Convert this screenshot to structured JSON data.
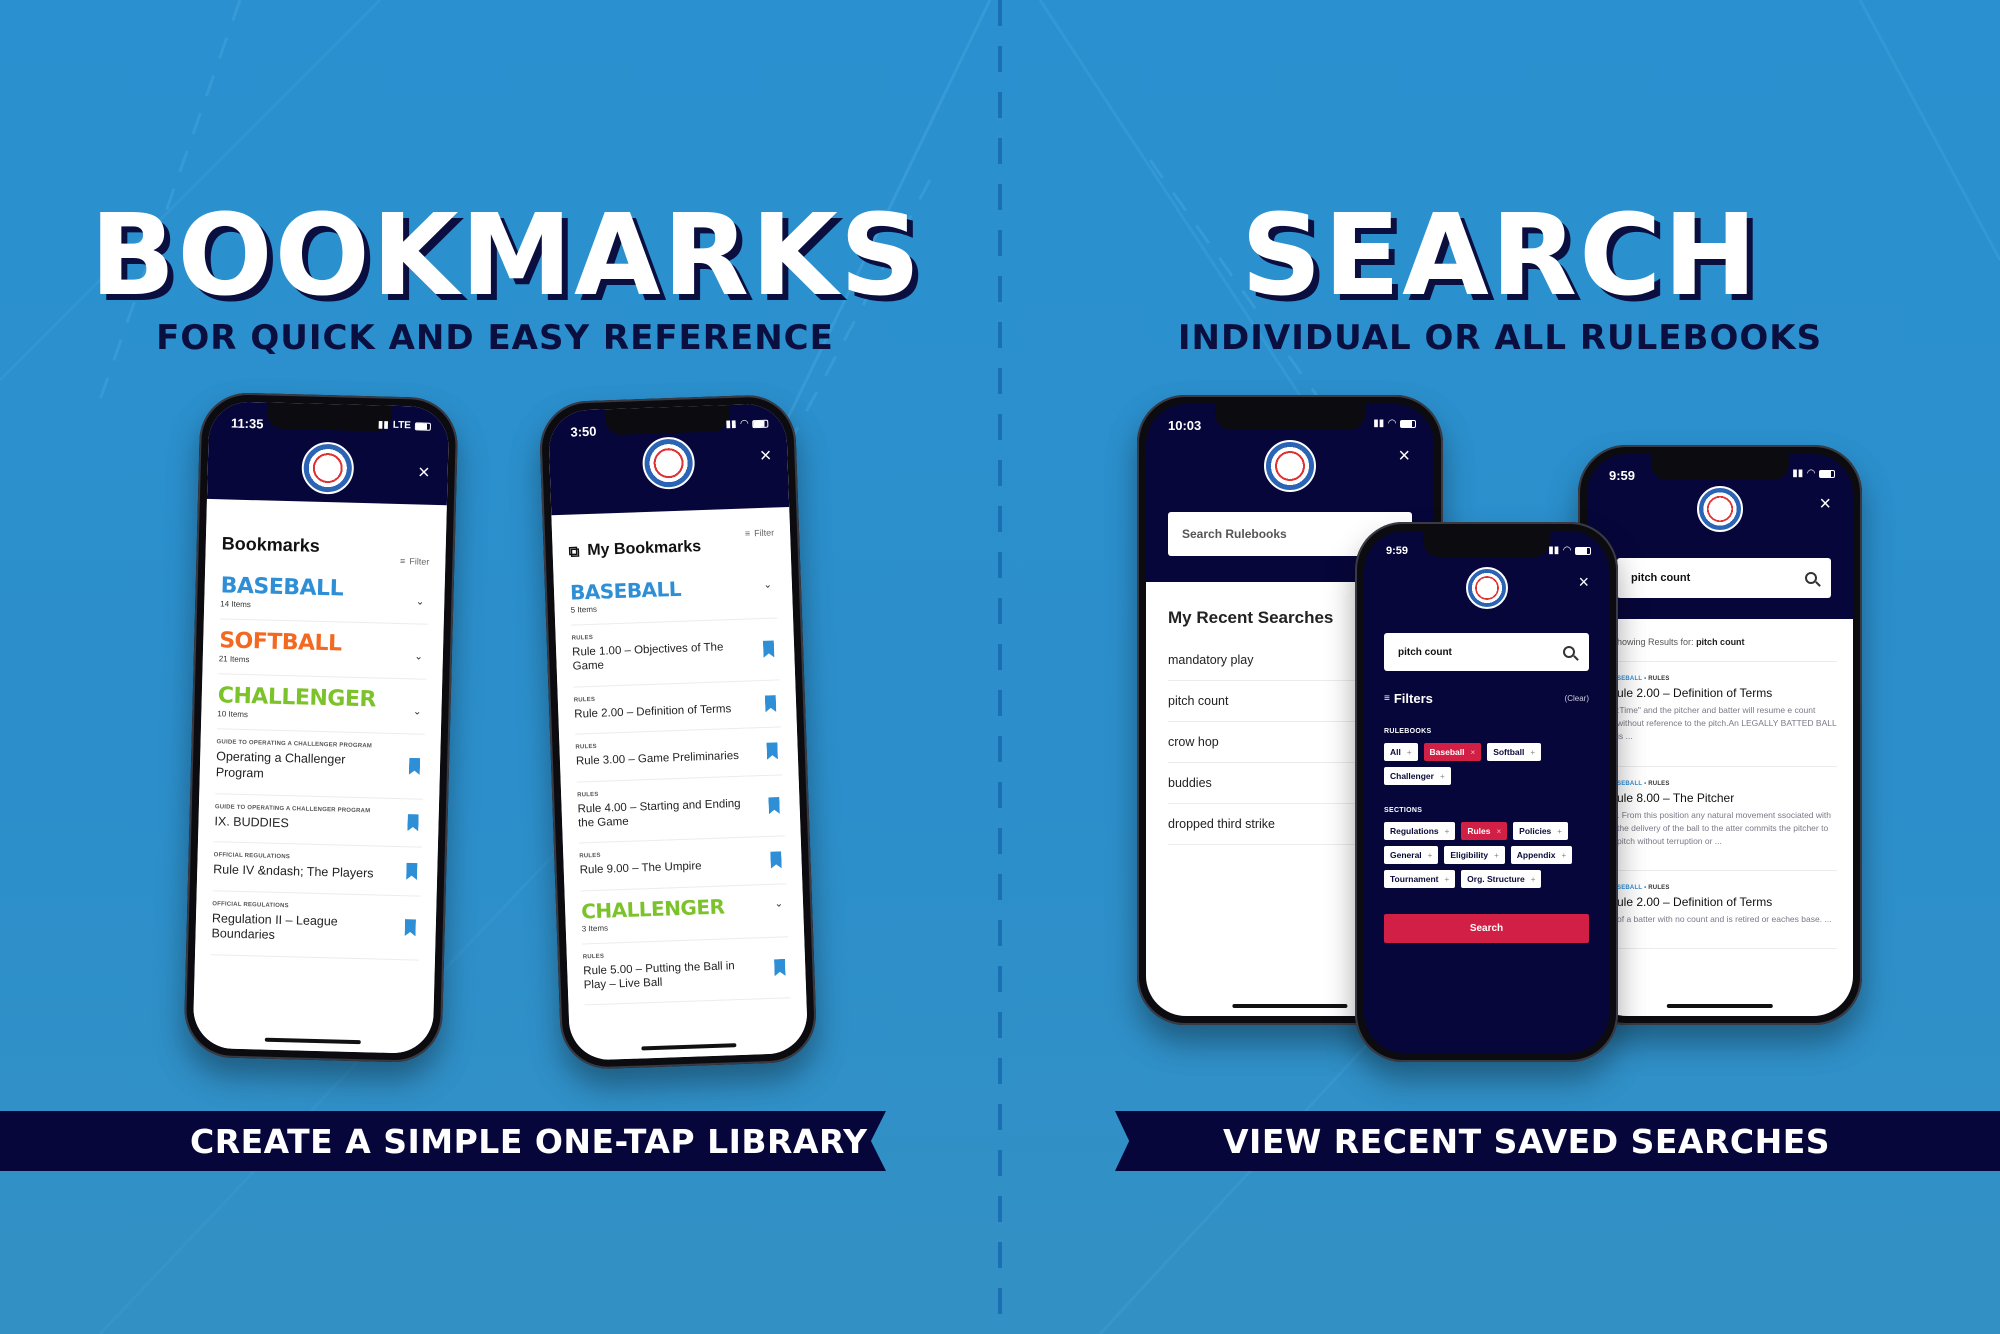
{
  "left_panel": {
    "headline": "BOOKMARKS",
    "subhead": "FOR QUICK AND EASY REFERENCE",
    "banner": "CREATE A SIMPLE ONE-TAP LIBRARY"
  },
  "right_panel": {
    "headline": "SEARCH",
    "subhead": "INDIVIDUAL OR ALL RULEBOOKS",
    "banner": "VIEW RECENT SAVED SEARCHES"
  },
  "colors": {
    "background": "#2a90cf",
    "navy": "#07063a",
    "baseball": "#2f8fd6",
    "softball": "#f26a21",
    "challenger": "#7cc22a",
    "active_chip": "#d21f45"
  },
  "phone_bookmarks_1": {
    "time": "11:35",
    "network": "LTE",
    "title": "Bookmarks",
    "filter_label": "Filter",
    "close_icon": "×",
    "categories": [
      {
        "name": "BASEBALL",
        "count": "14 Items",
        "color": "#2f8fd6"
      },
      {
        "name": "SOFTBALL",
        "count": "21 Items",
        "color": "#f26a21"
      },
      {
        "name": "CHALLENGER",
        "count": "10 Items",
        "color": "#7cc22a"
      }
    ],
    "items": [
      {
        "kicker": "Guide to Operating a Challenger Program",
        "title": "Operating a Challenger Program"
      },
      {
        "kicker": "Guide to Operating a Challenger Program",
        "title": "IX. BUDDIES"
      },
      {
        "kicker": "Official Regulations",
        "title": "Rule IV &ndash; The Players"
      },
      {
        "kicker": "Official Regulations",
        "title": "Regulation II – League Boundaries"
      }
    ]
  },
  "phone_bookmarks_2": {
    "time": "3:50",
    "title": "My Bookmarks",
    "filter_label": "Filter",
    "close_icon": "×",
    "baseball": {
      "name": "BASEBALL",
      "count": "5 Items"
    },
    "baseball_items": [
      {
        "kicker": "Rules",
        "title": "Rule 1.00 – Objectives of The Game"
      },
      {
        "kicker": "Rules",
        "title": "Rule 2.00 – Definition of Terms"
      },
      {
        "kicker": "Rules",
        "title": "Rule 3.00 – Game Preliminaries"
      },
      {
        "kicker": "Rules",
        "title": "Rule 4.00 – Starting and Ending the Game"
      },
      {
        "kicker": "Rules",
        "title": "Rule 9.00 – The Umpire"
      }
    ],
    "challenger": {
      "name": "CHALLENGER",
      "count": "3 Items"
    },
    "challenger_items": [
      {
        "kicker": "Rules",
        "title": "Rule 5.00 – Putting the Ball in Play – Live Ball"
      }
    ]
  },
  "phone_search_recent": {
    "time": "10:03",
    "close_icon": "×",
    "search_placeholder": "Search Rulebooks",
    "title": "My Recent Searches",
    "recent": [
      "mandatory play",
      "pitch count",
      "crow hop",
      "buddies",
      "dropped third strike"
    ]
  },
  "phone_search_filters": {
    "time": "9:59",
    "close_icon": "×",
    "query": "pitch count",
    "filters_label": "Filters",
    "clear_label": "(Clear)",
    "rulebooks_label": "RULEBOOKS",
    "rulebooks": [
      {
        "label": "All",
        "active": false
      },
      {
        "label": "Baseball",
        "active": true
      },
      {
        "label": "Softball",
        "active": false
      },
      {
        "label": "Challenger",
        "active": false
      }
    ],
    "sections_label": "SECTIONS",
    "sections": [
      {
        "label": "Regulations",
        "active": false
      },
      {
        "label": "Rules",
        "active": true
      },
      {
        "label": "Policies",
        "active": false
      },
      {
        "label": "General",
        "active": false
      },
      {
        "label": "Eligibility",
        "active": false
      },
      {
        "label": "Appendix",
        "active": false
      },
      {
        "label": "Tournament",
        "active": false
      },
      {
        "label": "Org. Structure",
        "active": false
      }
    ],
    "search_button": "Search"
  },
  "phone_search_results": {
    "time": "9:59",
    "close_icon": "×",
    "query": "pitch count",
    "showing_prefix": "howing Results for:",
    "showing_query": "pitch count",
    "results": [
      {
        "book": "SEBALL",
        "section": "RULES",
        "title": "ule 2.00 – Definition of Terms",
        "snippet": ":Time\" and the pitcher and batter will resume e count without reference to the pitch.An LEGALLY BATTED BALL is ..."
      },
      {
        "book": "SEBALL",
        "section": "RULES",
        "title": "ule 8.00 – The Pitcher",
        "snippet": ". From this position any natural movement ssociated with the delivery of the ball to the atter commits the pitcher to pitch without terruption or ..."
      },
      {
        "book": "SEBALL",
        "section": "RULES",
        "title": "ule 2.00 – Definition of Terms",
        "snippet": "of a batter with no count and is retired or eaches base. ..."
      }
    ]
  }
}
